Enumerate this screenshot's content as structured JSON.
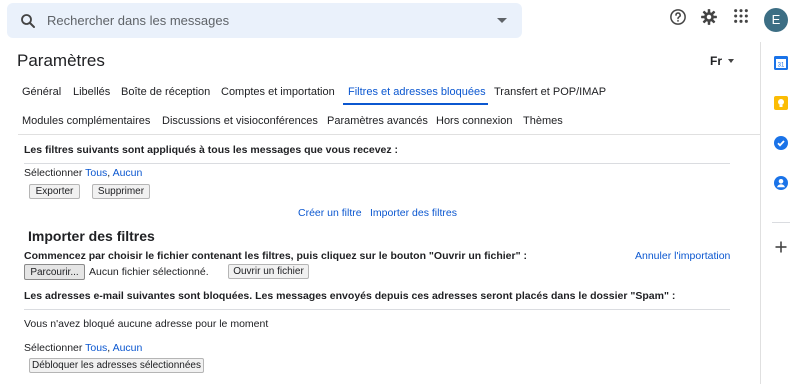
{
  "search": {
    "placeholder": "Rechercher dans les messages"
  },
  "account": {
    "avatar_letter": "E",
    "avatar_color": "#3c6e84"
  },
  "header": {
    "title": "Paramètres",
    "lang": "Fr"
  },
  "tabs_row1": [
    "Général",
    "Libellés",
    "Boîte de réception",
    "Comptes et importation",
    "Filtres et adresses bloquées",
    "Transfert et POP/IMAP"
  ],
  "tabs_row2": [
    "Modules complémentaires",
    "Discussions et visioconférences",
    "Paramètres avancés",
    "Hors connexion",
    "Thèmes"
  ],
  "active_tab": "Filtres et adresses bloquées",
  "filters": {
    "intro": "Les filtres suivants sont appliqués à tous les messages que vous recevez :",
    "select_label": "Sélectionner",
    "all": "Tous",
    "none": "Aucun",
    "export_btn": "Exporter",
    "delete_btn": "Supprimer",
    "create_link": "Créer un filtre",
    "import_link": "Importer des filtres"
  },
  "import": {
    "heading": "Importer des filtres",
    "instructions": "Commencez par choisir le fichier contenant les filtres, puis cliquez sur le bouton \"Ouvrir un fichier\" :",
    "cancel_link": "Annuler l'importation",
    "browse_btn": "Parcourir...",
    "no_file": "Aucun fichier sélectionné.",
    "open_btn": "Ouvrir un fichier"
  },
  "blocked": {
    "intro": "Les adresses e-mail suivantes sont bloquées. Les messages envoyés depuis ces adresses seront placés dans le dossier \"Spam\" :",
    "empty": "Vous n'avez bloqué aucune adresse pour le moment",
    "select_label": "Sélectionner",
    "all": "Tous",
    "none": "Aucun",
    "unblock_btn": "Débloquer les adresses sélectionnées"
  },
  "colors": {
    "accent": "#0b57d0",
    "search_bg": "#eaf1fb"
  },
  "rail_icons": [
    "calendar-icon",
    "keep-icon",
    "tasks-icon",
    "contacts-icon",
    "add-icon"
  ]
}
